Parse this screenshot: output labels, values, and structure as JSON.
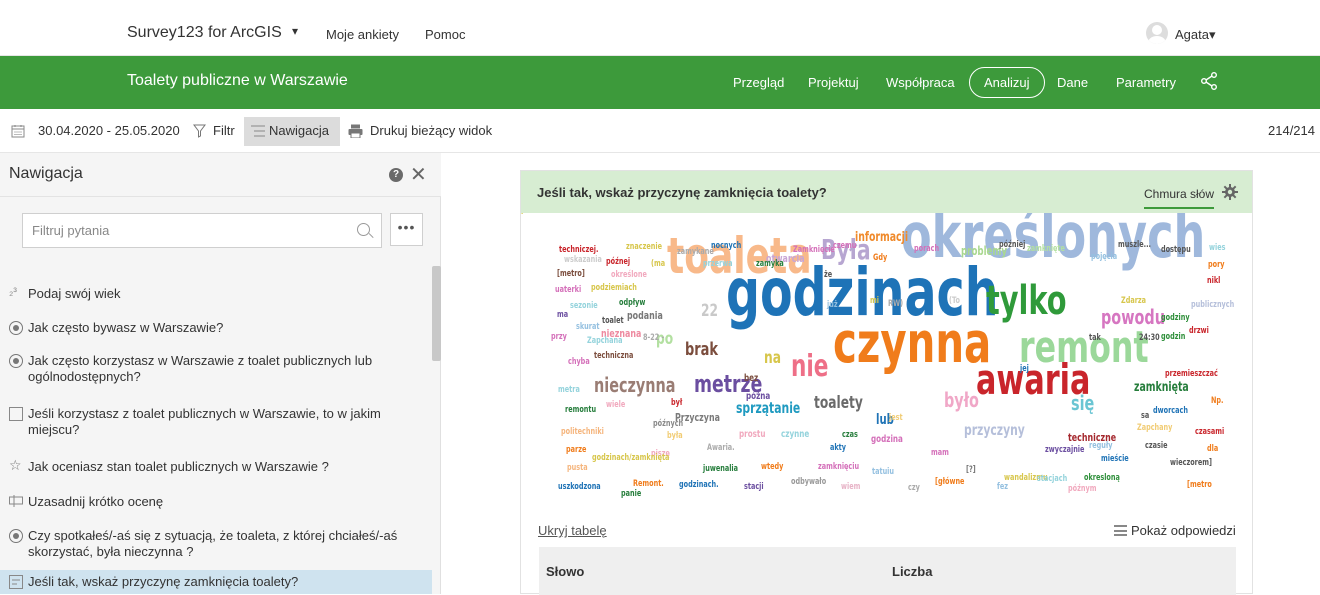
{
  "topbar": {
    "brand": "Survey123 for ArcGIS",
    "caret": "▾",
    "nav_my_surveys": "Moje ankiety",
    "nav_help": "Pomoc",
    "user": "Agata▾"
  },
  "header": {
    "title": "Toalety publiczne w Warszawie",
    "tabs": [
      "Przegląd",
      "Projektuj",
      "Współpraca",
      "Analizuj",
      "Dane",
      "Parametry"
    ],
    "active_tab": "Analizuj"
  },
  "toolbar": {
    "date_range": "30.04.2020 - 25.05.2020",
    "filter": "Filtr",
    "navigation": "Nawigacja",
    "print": "Drukuj bieżący widok",
    "count": "214/214"
  },
  "nav_panel": {
    "title": "Nawigacja",
    "filter_placeholder": "Filtruj pytania",
    "more": "•••",
    "questions": [
      {
        "type": "number",
        "icon": "₂³",
        "text": "Podaj swój wiek"
      },
      {
        "type": "radio",
        "text": "Jak często bywasz w Warszawie?"
      },
      {
        "type": "radio",
        "text": "Jak często korzystasz w Warszawie z toalet publicznych lub ogólnodostępnych?"
      },
      {
        "type": "checkbox",
        "text": "Jeśli korzystasz z toalet publicznych w Warszawie, to w jakim miejscu?"
      },
      {
        "type": "rating",
        "text": "Jak oceniasz stan toalet publicznych w Warszawie ?"
      },
      {
        "type": "text",
        "text": "Uzasadnij krótko ocenę"
      },
      {
        "type": "radio",
        "text": "Czy spotkałeś/-aś się z sytuacją, że toaleta, z której chciałeś/-aś skorzystać, była nieczynna ?"
      },
      {
        "type": "multiline",
        "text": "Jeśli tak, wskaż przyczynę zamknięcia toalety?"
      }
    ]
  },
  "card": {
    "question": "Jeśli tak, wskaż przyczynę zamknięcia toalety?",
    "view_tab": "Chmura słów",
    "hide_table": "Ukryj tabelę",
    "show_answers": "Pokaż odpowiedzi",
    "table_headers": [
      "Słowo",
      "Liczba"
    ]
  },
  "word_cloud": [
    {
      "w": "godzinach",
      "s": 66,
      "c": "#1e73b7"
    },
    {
      "w": "określonych",
      "s": 62,
      "c": "#9fb8dc"
    },
    {
      "w": "czynna",
      "s": 56,
      "c": "#f07c1b"
    },
    {
      "w": "toaleta",
      "s": 50,
      "c": "#f8b98a"
    },
    {
      "w": "remont",
      "s": 44,
      "c": "#9bd89a"
    },
    {
      "w": "awaria",
      "s": 42,
      "c": "#c9252b"
    },
    {
      "w": "tylko",
      "s": 40,
      "c": "#2f9a3a"
    },
    {
      "w": "Była",
      "s": 28,
      "c": "#b7a6d1"
    },
    {
      "w": "nie",
      "s": 30,
      "c": "#ee6f87"
    },
    {
      "w": "metrze",
      "s": 24,
      "c": "#6b4ea0"
    },
    {
      "w": "nieczynna",
      "s": 20,
      "c": "#9a7d74"
    },
    {
      "w": "powodu",
      "s": 20,
      "c": "#d676c1"
    },
    {
      "w": "było",
      "s": 20,
      "c": "#f0a7c7"
    },
    {
      "w": "się",
      "s": 20,
      "c": "#6ac5d3"
    },
    {
      "w": "brak",
      "s": 18,
      "c": "#7b4d3d"
    },
    {
      "w": "toalety",
      "s": 17,
      "c": "#6a6a6a"
    },
    {
      "w": "sprzątanie",
      "s": 15,
      "c": "#1f9ac0"
    },
    {
      "w": "przyczyny",
      "s": 15,
      "c": "#b5bfda"
    },
    {
      "w": "po",
      "s": 17,
      "c": "#b3e0a1"
    },
    {
      "w": "na",
      "s": 17,
      "c": "#d7c64b"
    },
    {
      "w": "22",
      "s": 17,
      "c": "#c9c9c9"
    },
    {
      "w": "zamknięta",
      "s": 13,
      "c": "#257d3b"
    },
    {
      "w": "lub",
      "s": 14,
      "c": "#1f73b6"
    },
    {
      "w": "informacji",
      "s": 13,
      "c": "#f08a2b"
    },
    {
      "w": "problemy",
      "s": 12,
      "c": "#a9d88f"
    },
    {
      "w": "Przyczyna",
      "s": 11,
      "c": "#7a7a7a"
    },
    {
      "w": "podania",
      "s": 11,
      "c": "#777777"
    },
    {
      "w": "nieznana",
      "s": 11,
      "c": "#ee8aa0"
    },
    {
      "w": "techniczne",
      "s": 11,
      "c": "#a4262c"
    },
    {
      "w": "otwarcia",
      "s": 11,
      "c": "#c8a5d5"
    },
    {
      "w": "prostu",
      "s": 10,
      "c": "#f1a9be"
    },
    {
      "w": "czynne",
      "s": 10,
      "c": "#94d3dc"
    },
    {
      "w": "godzina",
      "s": 10,
      "c": "#d46fb9"
    },
    {
      "w": "godziny",
      "s": 9,
      "c": "#2e8f3a"
    },
    {
      "w": "godzin",
      "s": 9,
      "c": "#2e8f3a"
    },
    {
      "w": "drzwi",
      "s": 9,
      "c": "#c9252b"
    },
    {
      "w": "przemieszczać",
      "s": 9,
      "c": "#c9252b"
    },
    {
      "w": "dworcach",
      "s": 9,
      "c": "#1f73b6"
    },
    {
      "w": "czasami",
      "s": 9,
      "c": "#c9252b"
    },
    {
      "w": "mieście",
      "s": 9,
      "c": "#1f73b6"
    },
    {
      "w": "wieczorem]",
      "s": 9,
      "c": "#555555"
    },
    {
      "w": "okresloną",
      "s": 9,
      "c": "#2e8f3a"
    },
    {
      "w": "[metro",
      "s": 9,
      "c": "#f07c1b"
    },
    {
      "w": "techniczna",
      "s": 9,
      "c": "#7b4d3d"
    },
    {
      "w": "chyba",
      "s": 9,
      "c": "#d46fb9"
    },
    {
      "w": "remontu",
      "s": 9,
      "c": "#257d3b"
    },
    {
      "w": "politechniki",
      "s": 9,
      "c": "#f5b57d"
    },
    {
      "w": "uszkodzona",
      "s": 9,
      "c": "#1f73b6"
    },
    {
      "w": "juwenalia",
      "s": 9,
      "c": "#257d3b"
    },
    {
      "w": "Remont.",
      "s": 9,
      "c": "#f07c1b"
    },
    {
      "w": "godzinach.",
      "s": 9,
      "c": "#1f73b6"
    },
    {
      "w": "stacji",
      "s": 9,
      "c": "#6b4ea0"
    },
    {
      "w": "odbywało",
      "s": 9,
      "c": "#999999"
    },
    {
      "w": "wiem",
      "s": 9,
      "c": "#e7b2c6"
    },
    {
      "w": "późnej",
      "s": 9,
      "c": "#c9252b"
    },
    {
      "w": "techniczej.",
      "s": 9,
      "c": "#c9252b"
    },
    {
      "w": "Zamknięcie",
      "s": 9,
      "c": "#d46fb9"
    },
    {
      "w": "nocnych",
      "s": 9,
      "c": "#1f73b6"
    },
    {
      "w": "Gdy",
      "s": 9,
      "c": "#f07c1b"
    },
    {
      "w": "dostępu",
      "s": 9,
      "c": "#555555"
    },
    {
      "w": "muszle...",
      "s": 9,
      "c": "#555555"
    },
    {
      "w": "pojęcia",
      "s": 9,
      "c": "#94c0e0"
    },
    {
      "w": "zamknięte",
      "s": 9,
      "c": "#b3e0a1"
    },
    {
      "w": "porach",
      "s": 9,
      "c": "#d46fb9"
    },
    {
      "w": "jest",
      "s": 9,
      "c": "#f1cc74"
    },
    {
      "w": "sa",
      "s": 9,
      "c": "#555555"
    },
    {
      "w": "bez",
      "s": 10,
      "c": "#7b4d3d"
    },
    {
      "w": "późna",
      "s": 10,
      "c": "#6b4ea0"
    },
    {
      "w": "był",
      "s": 9,
      "c": "#c9252b"
    },
    {
      "w": "czasie",
      "s": 9,
      "c": "#555555"
    },
    {
      "w": "dla",
      "s": 9,
      "c": "#f07c1b"
    },
    {
      "w": "akty",
      "s": 9,
      "c": "#1f73b6"
    },
    {
      "w": "mam",
      "s": 9,
      "c": "#d46fb9"
    },
    {
      "w": "metra",
      "s": 9,
      "c": "#94d3dc"
    },
    {
      "w": "wiele",
      "s": 9,
      "c": "#f1a9be"
    },
    {
      "w": "późnych",
      "s": 9,
      "c": "#888888"
    },
    {
      "w": "czas",
      "s": 9,
      "c": "#257d3b"
    },
    {
      "w": "Awaria.",
      "s": 9,
      "c": "#aaaaaa"
    },
    {
      "w": "była",
      "s": 9,
      "c": "#f1cc74"
    },
    {
      "w": "piszę",
      "s": 9,
      "c": "#f1a9be"
    },
    {
      "w": "godzinach/zamknięta",
      "s": 9,
      "c": "#d7c64b"
    },
    {
      "w": "panie",
      "s": 9,
      "c": "#257d3b"
    },
    {
      "w": "wtedy",
      "s": 9,
      "c": "#f07c1b"
    },
    {
      "w": "zamknięciu",
      "s": 9,
      "c": "#d46fb9"
    },
    {
      "w": "tatuiu",
      "s": 9,
      "c": "#94c0e0"
    },
    {
      "w": "[główne",
      "s": 9,
      "c": "#f07c1b"
    },
    {
      "w": "wandalizmu",
      "s": 9,
      "c": "#d7c64b"
    },
    {
      "w": "stacjach",
      "s": 9,
      "c": "#94d3dc"
    },
    {
      "w": "późnym",
      "s": 9,
      "c": "#f1a9be"
    },
    {
      "w": "zwyczajnie",
      "s": 9,
      "c": "#6b4ea0"
    },
    {
      "w": "reguły",
      "s": 9,
      "c": "#94c0e0"
    },
    {
      "w": "Zapchany",
      "s": 9,
      "c": "#f1cc74"
    },
    {
      "w": "Np.",
      "s": 9,
      "c": "#f07c1b"
    },
    {
      "w": "publicznych",
      "s": 9,
      "c": "#b5bfda"
    },
    {
      "w": "Zdarza",
      "s": 9,
      "c": "#d7c64b"
    },
    {
      "w": "nikl",
      "s": 9,
      "c": "#c9252b"
    },
    {
      "w": "pory",
      "s": 9,
      "c": "#f07c1b"
    },
    {
      "w": "wies",
      "s": 9,
      "c": "#94d3dc"
    },
    {
      "w": "wskazania",
      "s": 9,
      "c": "#cccccc"
    },
    {
      "w": "znaczenie",
      "s": 9,
      "c": "#d7c64b"
    },
    {
      "w": "zamykane",
      "s": 9,
      "c": "#aaaaaa"
    },
    {
      "w": "przerwa",
      "s": 9,
      "c": "#94d3dc"
    },
    {
      "w": "zamyka",
      "s": 9,
      "c": "#257d3b"
    },
    {
      "w": "(ma",
      "s": 9,
      "c": "#d7c64b"
    },
    {
      "w": "[metro]",
      "s": 9,
      "c": "#7b4d3d"
    },
    {
      "w": "określone",
      "s": 9,
      "c": "#f1a9be"
    },
    {
      "w": "uaterki",
      "s": 9,
      "c": "#d46fb9"
    },
    {
      "w": "podziemiach",
      "s": 9,
      "c": "#d7c64b"
    },
    {
      "w": "sezonie",
      "s": 9,
      "c": "#94d3dc"
    },
    {
      "w": "odpływ",
      "s": 9,
      "c": "#257d3b"
    },
    {
      "w": "ma",
      "s": 9,
      "c": "#6b4ea0"
    },
    {
      "w": "toalet",
      "s": 9,
      "c": "#555555"
    },
    {
      "w": "skurat",
      "s": 9,
      "c": "#94c0e0"
    },
    {
      "w": "przy",
      "s": 9,
      "c": "#d46fb9"
    },
    {
      "w": "Zapchana",
      "s": 9,
      "c": "#94d3dc"
    },
    {
      "w": "8-22 -",
      "s": 9,
      "c": "#aaaaaa"
    },
    {
      "w": "mi",
      "s": 9,
      "c": "#d7c64b"
    },
    {
      "w": "już",
      "s": 9,
      "c": "#94c0e0"
    },
    {
      "w": "RW)",
      "s": 9,
      "c": "#aaaaaa"
    },
    {
      "w": "(To",
      "s": 9,
      "c": "#cccccc"
    },
    {
      "w": "jej",
      "s": 9,
      "c": "#1f73b6"
    },
    {
      "w": "tak",
      "s": 9,
      "c": "#555555"
    },
    {
      "w": "24:30",
      "s": 9,
      "c": "#555555"
    },
    {
      "w": "że",
      "s": 9,
      "c": "#555555"
    },
    {
      "w": "czemu",
      "s": 9,
      "c": "#d46fb9"
    },
    {
      "w": "później",
      "s": 9,
      "c": "#555555"
    },
    {
      "w": "fez",
      "s": 9,
      "c": "#94c0e0"
    },
    {
      "w": "[?]",
      "s": 9,
      "c": "#777777"
    },
    {
      "w": "czy",
      "s": 9,
      "c": "#aaaaaa"
    },
    {
      "w": "parze",
      "s": 9,
      "c": "#f07c1b"
    },
    {
      "w": "pusta",
      "s": 9,
      "c": "#f5b57d"
    },
    {
      "w": "pusze",
      "s": 9,
      "c": "#d7c64b"
    }
  ]
}
